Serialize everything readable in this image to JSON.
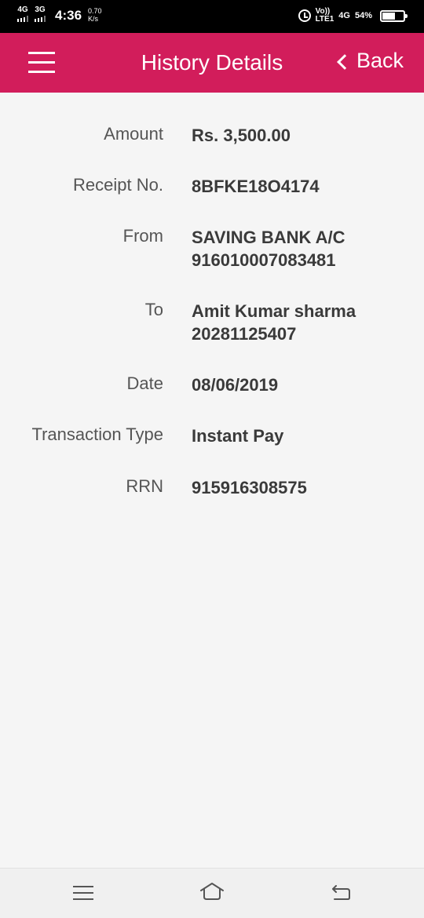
{
  "status_bar": {
    "net1": "4G",
    "net2": "3G",
    "time": "4:36",
    "speed_value": "0.70",
    "speed_unit": "K/s",
    "volte_top": "Vo))",
    "volte_bottom": "LTE1",
    "net_right": "4G",
    "battery": "54%"
  },
  "header": {
    "title": "History Details",
    "back_label": "Back"
  },
  "details": [
    {
      "label": "Amount",
      "value": "Rs. 3,500.00"
    },
    {
      "label": "Receipt No.",
      "value": "8BFKE18O4174"
    },
    {
      "label": "From",
      "value_line1": "SAVING BANK A/C",
      "value_line2": "916010007083481"
    },
    {
      "label": "To",
      "value_line1": "Amit Kumar sharma",
      "value_line2": "20281125407"
    },
    {
      "label": "Date",
      "value": "08/06/2019"
    },
    {
      "label": "Transaction Type",
      "value": "Instant Pay"
    },
    {
      "label": "RRN",
      "value": "915916308575"
    }
  ]
}
